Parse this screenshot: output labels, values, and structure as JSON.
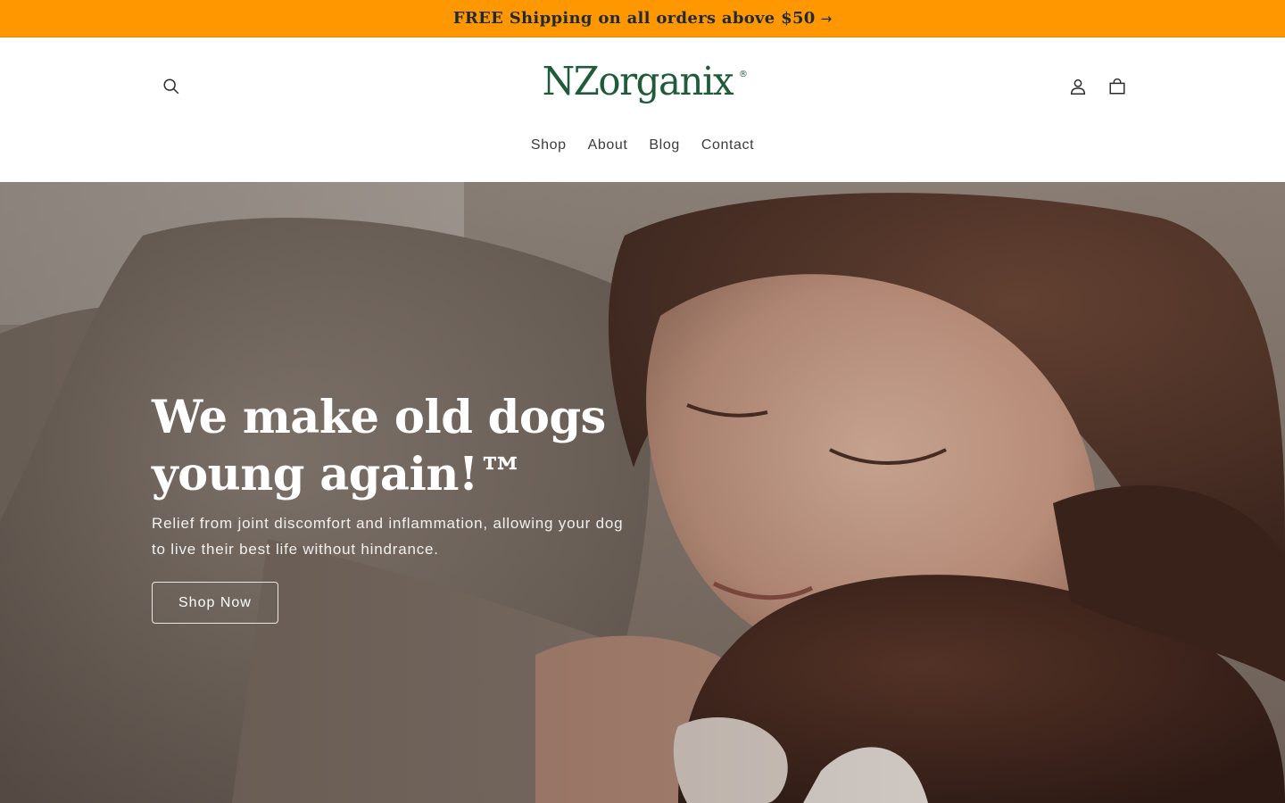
{
  "colors": {
    "announcement_bg": "#ff9800",
    "logo_green": "#1f5a3a",
    "accent_dark": "#1f2a36"
  },
  "announcement": {
    "text": "FREE Shipping on all orders above $50",
    "arrow": "→"
  },
  "header": {
    "logo_text": "NZorganix",
    "logo_mark": "®",
    "search_icon": "search-icon",
    "account_icon": "user-icon",
    "cart_icon": "cart-icon"
  },
  "nav": {
    "items": [
      {
        "label": "Shop"
      },
      {
        "label": "About"
      },
      {
        "label": "Blog"
      },
      {
        "label": "Contact"
      }
    ]
  },
  "hero": {
    "title_line1": "We make old dogs",
    "title_line2": "young again!™",
    "subtitle_line1": "Relief from joint discomfort and inflammation, allowing your dog",
    "subtitle_line2": "to live their best life without hindrance.",
    "button_label": "Shop Now"
  }
}
